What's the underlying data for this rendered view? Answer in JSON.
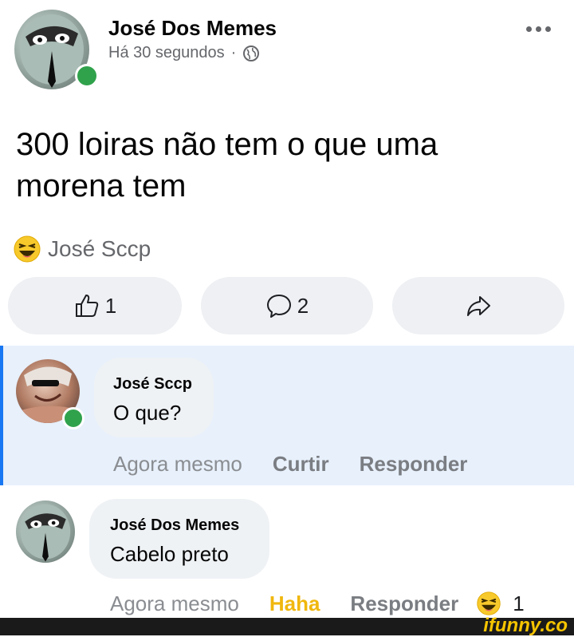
{
  "post": {
    "author": "José Dos Memes",
    "time": "Há 30 segundos",
    "separator": "·",
    "text_line1": "300 loiras não tem o que uma",
    "text_line2": "morena tem",
    "reactor": "José Sccp",
    "like_count": "1",
    "comment_count": "2"
  },
  "comments": [
    {
      "author": "José Sccp",
      "text": "O que?",
      "time": "Agora mesmo",
      "action1": "Curtir",
      "action2": "Responder"
    },
    {
      "author": "José Dos Memes",
      "text": "Cabelo preto",
      "time": "Agora mesmo",
      "action1": "Haha",
      "action2": "Responder",
      "reaction_count": "1"
    }
  ],
  "watermark": "ifunny.co",
  "colors": {
    "online": "#31a24c",
    "haha": "#f0b70d",
    "highlight_bg": "#e7f0fb",
    "highlight_border": "#1877f2"
  }
}
